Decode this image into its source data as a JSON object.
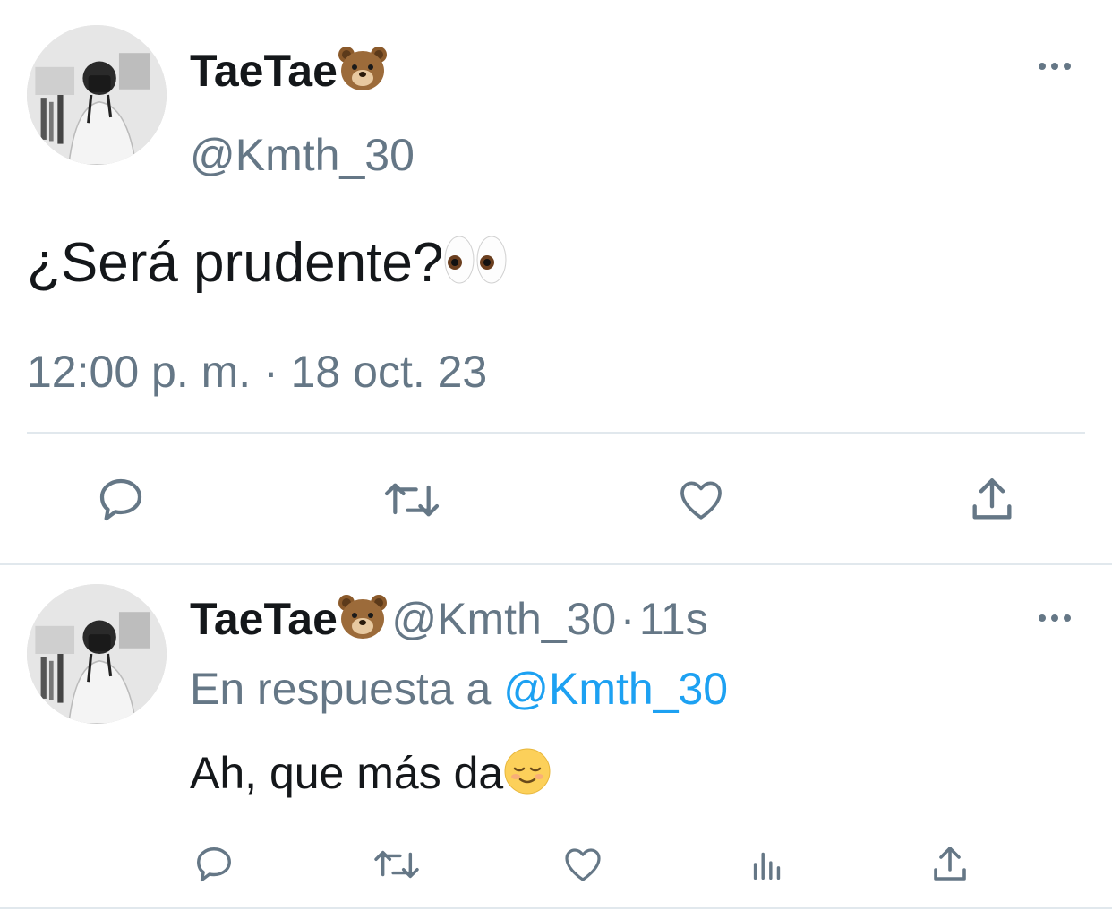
{
  "main_tweet": {
    "author_name": "TaeTae",
    "name_emoji": "bear-face-emoji",
    "handle": "@Kmth_30",
    "text": "¿Será prudente?",
    "text_emoji": "eyes-emoji",
    "time": "12:00 p. m.",
    "separator": "·",
    "date": "18 oct. 23",
    "actions": [
      "reply-icon",
      "retweet-icon",
      "like-icon",
      "share-icon"
    ]
  },
  "reply_tweet": {
    "author_name": "TaeTae",
    "name_emoji": "bear-face-emoji",
    "handle": "@Kmth_30",
    "separator": "·",
    "time_ago": "11s",
    "reply_prefix": "En respuesta a",
    "reply_handle": "@Kmth_30",
    "text": "Ah, que más da",
    "text_emoji": "relieved-face-emoji",
    "actions": [
      "reply-icon",
      "retweet-icon",
      "like-icon",
      "analytics-icon",
      "share-icon"
    ]
  },
  "colors": {
    "text": "#14171a",
    "secondary": "#657786",
    "link": "#1da1f2",
    "divider": "#e1e8ed"
  }
}
